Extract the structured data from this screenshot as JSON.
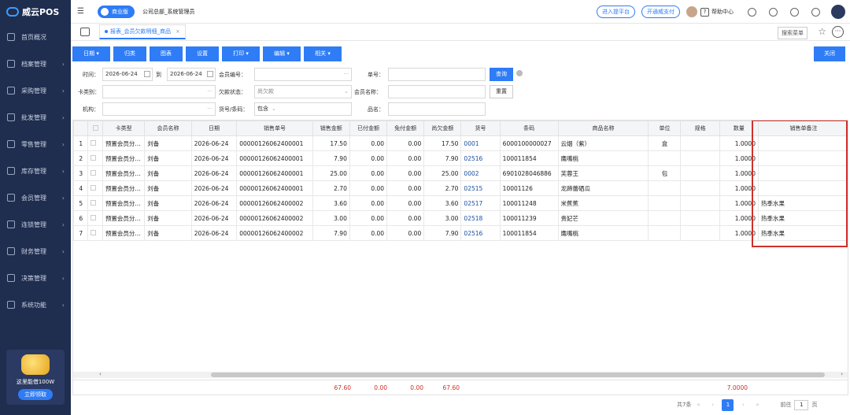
{
  "app": {
    "name": "威云POS",
    "edition": "商业版",
    "company": "公司总部_系统管理员"
  },
  "sidebar": {
    "items": [
      {
        "label": "首页概况",
        "icon": "home-icon"
      },
      {
        "label": "档案管理",
        "icon": "archive-icon"
      },
      {
        "label": "采购管理",
        "icon": "cart-icon"
      },
      {
        "label": "批发管理",
        "icon": "box-icon"
      },
      {
        "label": "零售管理",
        "icon": "store-icon"
      },
      {
        "label": "库存管理",
        "icon": "warehouse-icon"
      },
      {
        "label": "会员管理",
        "icon": "member-icon"
      },
      {
        "label": "连锁管理",
        "icon": "chain-icon"
      },
      {
        "label": "财务管理",
        "icon": "finance-icon"
      },
      {
        "label": "决策管理",
        "icon": "decision-icon"
      },
      {
        "label": "系统功能",
        "icon": "settings-icon"
      }
    ],
    "promo": {
      "text": "这里能借100W",
      "button": "立即领取"
    }
  },
  "header": {
    "pill1": "进入提平台",
    "pill2": "开通威支付",
    "help": "帮助中心"
  },
  "tabs": {
    "active": "报表_会员欠款明细_商品",
    "search": "搜索菜单"
  },
  "toolbar": {
    "buttons": [
      "日期 ▾",
      "归类",
      "图表",
      "设置",
      "打印 ▾",
      "编辑 ▾",
      "相关 ▾"
    ],
    "close": "关闭"
  },
  "filters": {
    "time_label": "时间：",
    "date_from": "2026-06-24",
    "to": "到",
    "date_to": "2026-06-24",
    "member_no_label": "会员编号：",
    "bill_no_label": "单号：",
    "query": "查询",
    "card_type_label": "卡类别：",
    "arrears_label": "欠款状态：",
    "arrears_value": "尚欠款",
    "member_name_label": "会员名称：",
    "reset": "重置",
    "org_label": "机构：",
    "goods_label": "货号/条码：",
    "goods_value": "包含",
    "product_label": "品名："
  },
  "table": {
    "headers": [
      "",
      "",
      "卡类型",
      "会员名称",
      "日期",
      "销售单号",
      "销售金额",
      "已付金额",
      "免付金额",
      "尚欠金额",
      "货号",
      "条码",
      "商品名称",
      "单位",
      "规格",
      "数量",
      "销售单备注"
    ],
    "rows": [
      [
        "1",
        "",
        "预置会员分...",
        "刘备",
        "2026-06-24",
        "00000126062400001",
        "17.50",
        "0.00",
        "0.00",
        "17.50",
        "0001",
        "6000100000027",
        "云烟（紫）",
        "盒",
        "",
        "1.0000",
        ""
      ],
      [
        "2",
        "",
        "预置会员分...",
        "刘备",
        "2026-06-24",
        "00000126062400001",
        "7.90",
        "0.00",
        "0.00",
        "7.90",
        "02516",
        "100011854",
        "鹰嘴桃",
        "",
        "",
        "1.0000",
        ""
      ],
      [
        "3",
        "",
        "预置会员分...",
        "刘备",
        "2026-06-24",
        "00000126062400001",
        "25.00",
        "0.00",
        "0.00",
        "25.00",
        "0002",
        "6901028046886",
        "芙蓉王",
        "包",
        "",
        "1.0000",
        ""
      ],
      [
        "4",
        "",
        "预置会员分...",
        "刘备",
        "2026-06-24",
        "00000126062400001",
        "2.70",
        "0.00",
        "0.00",
        "2.70",
        "02515",
        "10001126",
        "龙蹄蕾硒瓜",
        "",
        "",
        "1.0000",
        ""
      ],
      [
        "5",
        "",
        "预置会员分...",
        "刘备",
        "2026-06-24",
        "00000126062400002",
        "3.60",
        "0.00",
        "0.00",
        "3.60",
        "02517",
        "100011248",
        "米蕉蕉",
        "",
        "",
        "1.0000",
        "热季水果"
      ],
      [
        "6",
        "",
        "预置会员分...",
        "刘备",
        "2026-06-24",
        "00000126062400002",
        "3.00",
        "0.00",
        "0.00",
        "3.00",
        "02518",
        "100011239",
        "贵妃芒",
        "",
        "",
        "1.0000",
        "热季水果"
      ],
      [
        "7",
        "",
        "预置会员分...",
        "刘备",
        "2026-06-24",
        "00000126062400002",
        "7.90",
        "0.00",
        "0.00",
        "7.90",
        "02516",
        "100011854",
        "鹰嘴桃",
        "",
        "",
        "1.0000",
        "热季水果"
      ]
    ],
    "totals": {
      "sales": "67.60",
      "paid": "0.00",
      "waived": "0.00",
      "owed": "67.60",
      "qty": "7.0000"
    }
  },
  "pager": {
    "total": "共7条",
    "current": "1",
    "goto_label": "前往",
    "goto_value": "1",
    "page_unit": "页"
  },
  "colors": {
    "accent": "#2e7cf6",
    "sidebar": "#1f2d4f",
    "highlight": "#d0302a"
  }
}
